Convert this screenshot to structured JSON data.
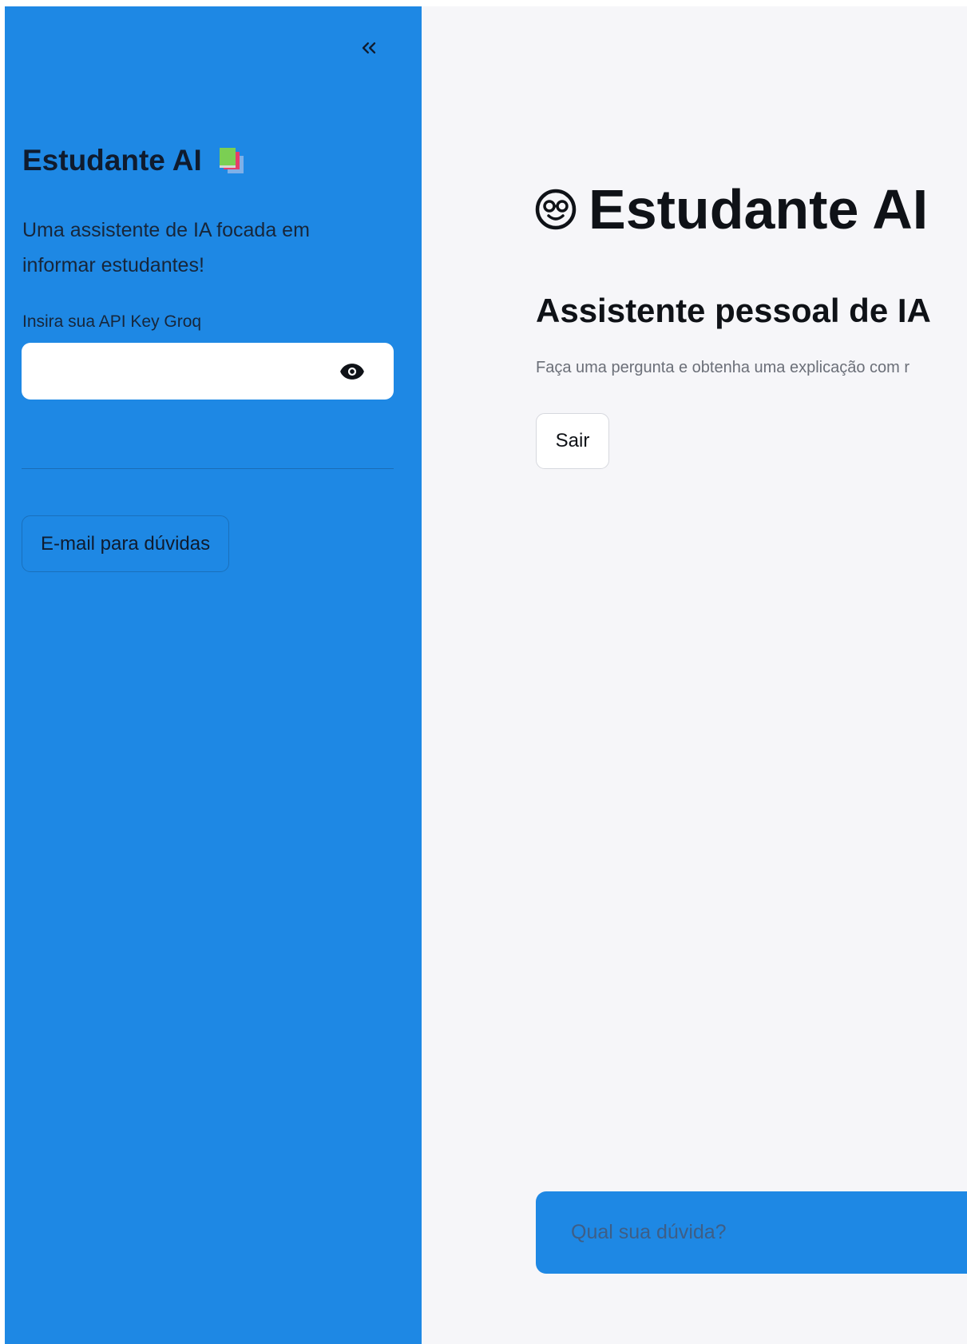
{
  "sidebar": {
    "title": "Estudante AI",
    "description": "Uma assistente de IA focada em informar estudantes!",
    "api_label": "Insira sua API Key Groq",
    "api_value": "",
    "email_button": "E-mail para dúvidas",
    "icons": {
      "collapse": "chevron-double-left-icon",
      "title_emoji": "books-icon",
      "toggle_visibility": "eye-icon"
    }
  },
  "main": {
    "title": "Estudante AI",
    "title_icon": "nerd-face-icon",
    "subtitle": "Assistente pessoal de IA",
    "caption": "Faça uma pergunta e obtenha uma explicação com r",
    "exit_button": "Sair",
    "chat_placeholder": "Qual sua dúvida?"
  },
  "colors": {
    "sidebar_bg": "#1e88e4",
    "main_bg": "#f6f6f9",
    "text_dark": "#0f1217"
  }
}
